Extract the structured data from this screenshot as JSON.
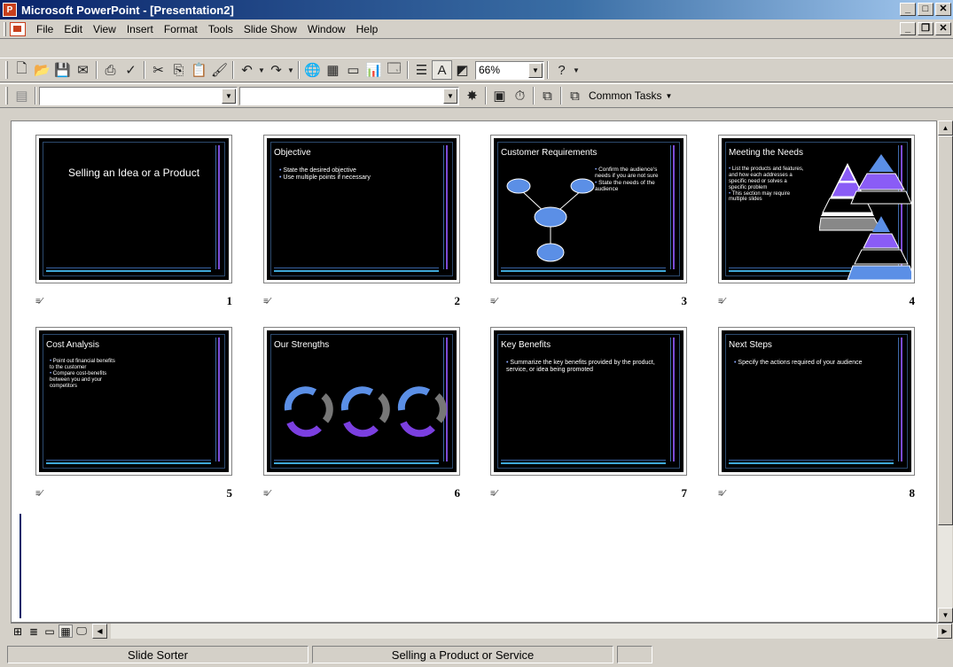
{
  "window": {
    "title": "Microsoft PowerPoint - [Presentation2]"
  },
  "menu": [
    "File",
    "Edit",
    "View",
    "Insert",
    "Format",
    "Tools",
    "Slide Show",
    "Window",
    "Help"
  ],
  "toolbar": {
    "zoom": "66%",
    "common_tasks": "Common Tasks"
  },
  "slides": [
    {
      "num": "1",
      "title": "Selling an Idea or a Product",
      "bullets": []
    },
    {
      "num": "2",
      "title": "Objective",
      "bullets": [
        "State the desired objective",
        "Use multiple points if necessary"
      ]
    },
    {
      "num": "3",
      "title": "Customer Requirements",
      "bullets": [
        "Confirm the audience's needs if you are not sure",
        "State the needs of the audience"
      ]
    },
    {
      "num": "4",
      "title": "Meeting the Needs",
      "bullets": [
        "List the products and features, and how each addresses a specific need or solves a specific problem",
        "This section may require multiple slides"
      ]
    },
    {
      "num": "5",
      "title": "Cost Analysis",
      "bullets": [
        "Point out financial benefits to the customer",
        "Compare cost-benefits between you and your competitors"
      ]
    },
    {
      "num": "6",
      "title": "Our Strengths",
      "bullets": []
    },
    {
      "num": "7",
      "title": "Key Benefits",
      "bullets": [
        "Summarize the key benefits provided by the product, service, or idea being promoted"
      ]
    },
    {
      "num": "8",
      "title": "Next Steps",
      "bullets": [
        "Specify the actions required of your audience"
      ]
    }
  ],
  "status": {
    "view": "Slide Sorter",
    "design": "Selling a Product or Service"
  },
  "colors": {
    "titlebar": "#0a246a",
    "accent_purple": "#7b4bd6",
    "accent_blue": "#3fa7d6"
  }
}
